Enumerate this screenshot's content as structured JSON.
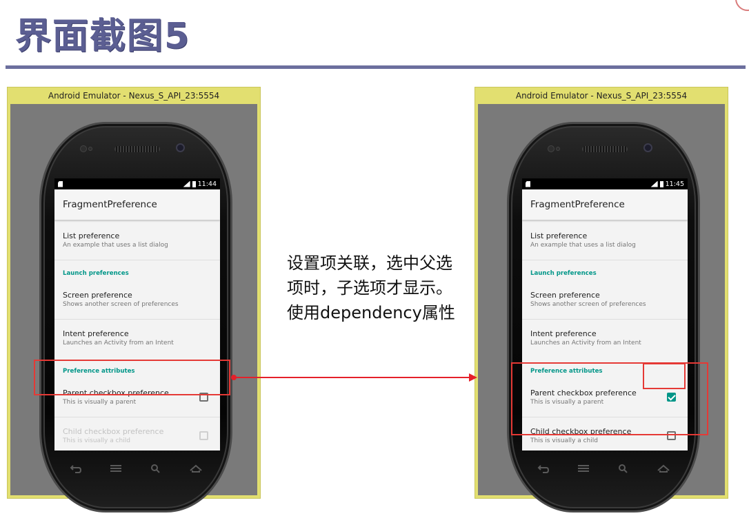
{
  "slide": {
    "title": "界面截图5",
    "note": "设置项关联，选中父选项时，子选项才显示。使用dependency属性"
  },
  "colors": {
    "title": "#5b5e92",
    "accent": "#009688",
    "annotation": "#e53935",
    "emulator_frame": "#e2df70"
  },
  "left_emulator": {
    "window_title": "Android Emulator - Nexus_S_API_23:5554",
    "status_time": "11:44",
    "app_title": "FragmentPreference",
    "list_pref": {
      "title": "List preference",
      "summary": "An example that uses a list dialog"
    },
    "cat_launch": "Launch preferences",
    "screen_pref": {
      "title": "Screen preference",
      "summary": "Shows another screen of preferences"
    },
    "intent_pref": {
      "title": "Intent preference",
      "summary": "Launches an Activity from an Intent"
    },
    "cat_attrs": "Preference attributes",
    "parent_pref": {
      "title": "Parent checkbox preference",
      "summary": "This is visually a parent",
      "checked": false
    },
    "child_pref": {
      "title": "Child checkbox preference",
      "summary": "This is visually a child",
      "checked": false,
      "enabled": false
    }
  },
  "right_emulator": {
    "window_title": "Android Emulator - Nexus_S_API_23:5554",
    "status_time": "11:45",
    "app_title": "FragmentPreference",
    "list_pref": {
      "title": "List preference",
      "summary": "An example that uses a list dialog"
    },
    "cat_launch": "Launch preferences",
    "screen_pref": {
      "title": "Screen preference",
      "summary": "Shows another screen of preferences"
    },
    "intent_pref": {
      "title": "Intent preference",
      "summary": "Launches an Activity from an Intent"
    },
    "cat_attrs": "Preference attributes",
    "parent_pref": {
      "title": "Parent checkbox preference",
      "summary": "This is visually a parent",
      "checked": true
    },
    "child_pref": {
      "title": "Child checkbox preference",
      "summary": "This is visually a child",
      "checked": false,
      "enabled": true
    }
  },
  "icons": {
    "nav": [
      "back-icon",
      "menu-icon",
      "search-icon",
      "home-icon"
    ],
    "status": [
      "sd-card-icon",
      "signal-icon",
      "battery-icon"
    ]
  }
}
